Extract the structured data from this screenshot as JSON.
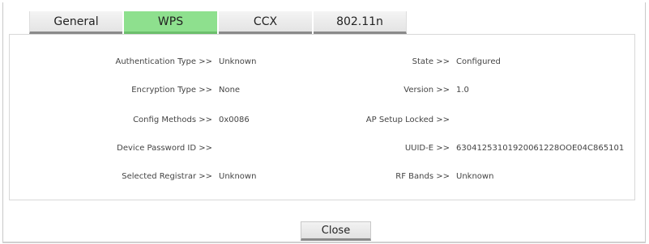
{
  "tabs": [
    {
      "label": "General"
    },
    {
      "label": "WPS"
    },
    {
      "label": "CCX"
    },
    {
      "label": "802.11n"
    }
  ],
  "left_fields": [
    {
      "label": "Authentication Type >>",
      "value": "Unknown"
    },
    {
      "label": "Encryption Type >>",
      "value": "None"
    },
    {
      "label": "Config Methods >>",
      "value": "0x0086"
    },
    {
      "label": "Device Password ID >>",
      "value": ""
    },
    {
      "label": "Selected Registrar >>",
      "value": "Unknown"
    }
  ],
  "right_fields": [
    {
      "label": "State >>",
      "value": "Configured"
    },
    {
      "label": "Version >>",
      "value": "1.0"
    },
    {
      "label": "AP Setup Locked >>",
      "value": ""
    },
    {
      "label": "UUID-E >>",
      "value": "63041253101920061228OOE04C865101"
    },
    {
      "label": "RF Bands >>",
      "value": "Unknown"
    }
  ],
  "close_button": {
    "label": "Close"
  },
  "colors": {
    "active_tab": "#8ee08e",
    "tab_underline": "#8a8a8a"
  }
}
